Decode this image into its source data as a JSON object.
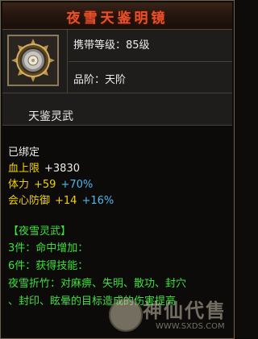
{
  "title": "夜雪天鉴明镜",
  "header": {
    "level_label": "携带等级：85级",
    "grade_label": "品阶：天阶",
    "item_name": "天鉴灵武",
    "icon": "spiked-mirror-icon"
  },
  "body": {
    "bound": "已绑定",
    "stats": [
      {
        "label": "血上限",
        "value": "+3830",
        "percent": ""
      },
      {
        "label": "体力",
        "value": "+59",
        "percent": "+70%"
      },
      {
        "label": "会心防御",
        "value": "+14",
        "percent": "+16%"
      }
    ],
    "set": {
      "name": "【夜雪灵武】",
      "piece3": "3件：命中增加：",
      "piece6": "6件：获得技能：",
      "skill_line1": "夜雪折竹：对麻痹、失明、散功、封穴",
      "skill_line2": "、封印、眩晕的目标造成的伤害提高"
    }
  },
  "watermark": {
    "text": "神仙代售",
    "url": "WWW.SXDS.COM"
  },
  "colors": {
    "title": "#e8512a",
    "stat_label": "#f2d200",
    "percent": "#4fb8f0",
    "set_text": "#3de03a"
  }
}
